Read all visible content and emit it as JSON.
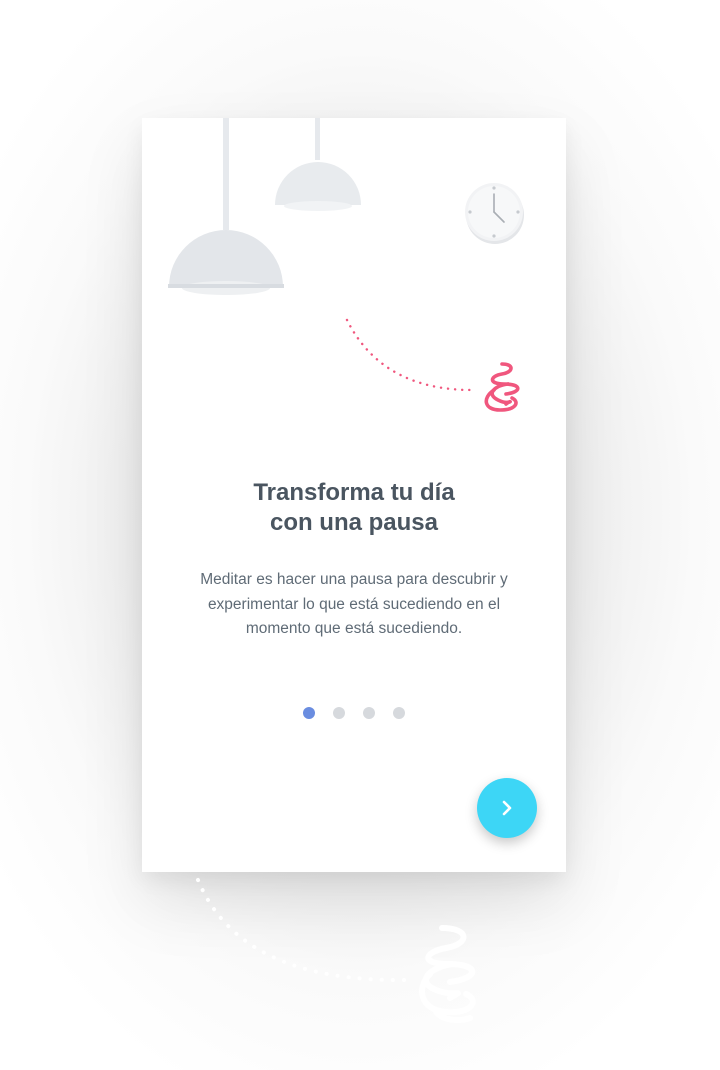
{
  "onboarding": {
    "title_line1": "Transforma tu día",
    "title_line2": "con una pausa",
    "description": "Meditar es hacer una pausa para descubrir y experimentar lo que está sucediendo en el momento que está sucediendo.",
    "pagination": {
      "total": 4,
      "active_index": 0
    },
    "next_button": {
      "icon": "chevron-right-icon"
    }
  },
  "colors": {
    "title": "#4a5560",
    "body_text": "#5f6b76",
    "accent_pink": "#f0577e",
    "dot_active": "#6a8de0",
    "dot_inactive": "#d6d9dd",
    "next_button": "#3dd6f6",
    "lamp": "#e6e9ed"
  },
  "illustration": {
    "elements": [
      "pendant-lamp-large",
      "pendant-lamp-small",
      "wall-clock-icon",
      "dotted-path",
      "brand-squiggle-icon"
    ]
  }
}
